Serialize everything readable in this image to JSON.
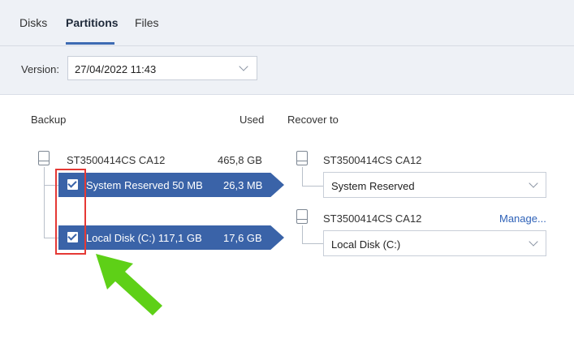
{
  "tabs": [
    {
      "label": "Disks"
    },
    {
      "label": "Partitions"
    },
    {
      "label": "Files"
    }
  ],
  "version": {
    "label": "Version:",
    "value": "27/04/2022 11:43"
  },
  "columns": {
    "backup": "Backup",
    "used": "Used",
    "recover_to": "Recover to"
  },
  "source_disk": {
    "name": "ST3500414CS CA12",
    "size": "465,8 GB"
  },
  "partitions": [
    {
      "name": "System Reserved 50 MB",
      "used": "26,3 MB",
      "checked": true
    },
    {
      "name": "Local Disk (C:) 117,1 GB",
      "used": "17,6 GB",
      "checked": true
    }
  ],
  "targets": [
    {
      "disk": "ST3500414CS CA12",
      "partition": "System Reserved"
    },
    {
      "disk": "ST3500414CS CA12",
      "partition": "Local Disk (C:)"
    }
  ],
  "manage_link": "Manage...",
  "colors": {
    "accent": "#3a63a8",
    "highlight": "#e53935",
    "arrow": "#5ed017"
  }
}
